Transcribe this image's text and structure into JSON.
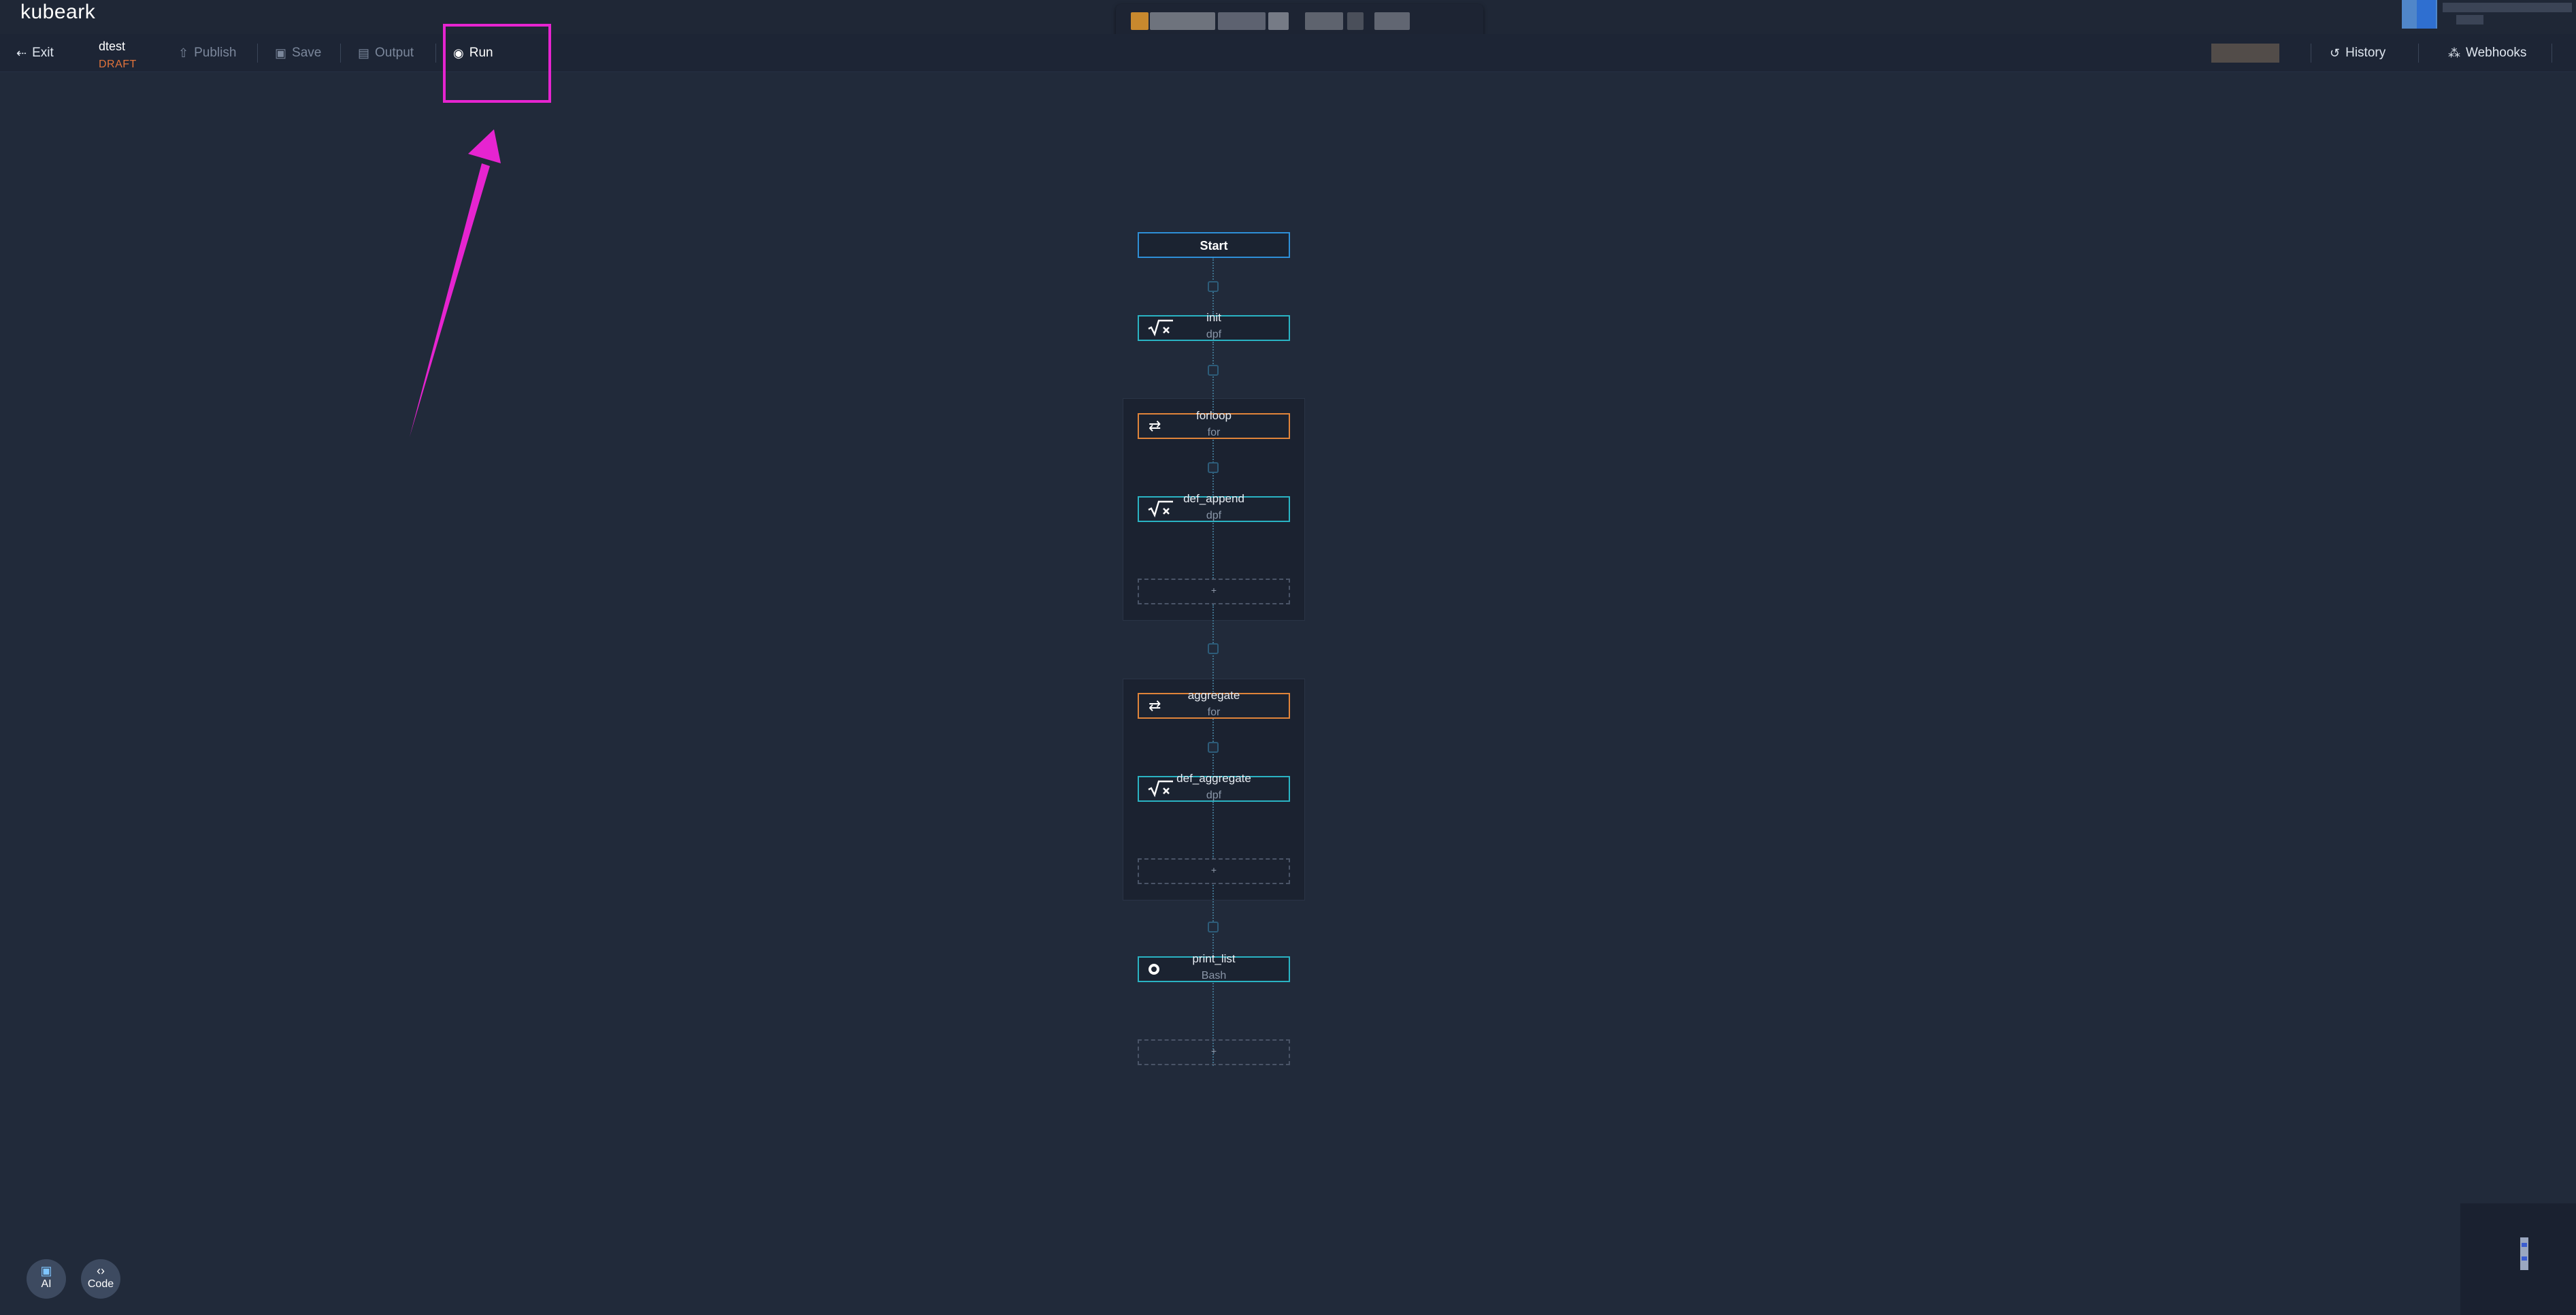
{
  "app": {
    "logo": "kubeark"
  },
  "toolbar": {
    "exit_label": "Exit",
    "flow_name": "dtest",
    "flow_status": "DRAFT",
    "publish_label": "Publish",
    "save_label": "Save",
    "output_label": "Output",
    "run_label": "Run",
    "history_label": "History",
    "webhooks_label": "Webhooks"
  },
  "workflow": {
    "start": {
      "title": "Start"
    },
    "nodes": [
      {
        "title": "init",
        "type": "dpf",
        "icon": "sqrt-x-icon"
      },
      {
        "title": "forloop",
        "type": "for",
        "icon": "loop-icon"
      },
      {
        "title": "def_append",
        "type": "dpf",
        "icon": "sqrt-x-icon"
      },
      {
        "title": "aggregate",
        "type": "for",
        "icon": "loop-icon"
      },
      {
        "title": "def_aggregate",
        "type": "dpf",
        "icon": "sqrt-x-icon"
      },
      {
        "title": "print_list",
        "type": "Bash",
        "icon": "bash-icon"
      }
    ],
    "placeholder_label": "+"
  },
  "fabs": {
    "ai_label": "AI",
    "code_label": "Code"
  },
  "colors": {
    "background": "#212a3a",
    "dpf_border": "#2ab3c3",
    "for_border": "#e0843a",
    "start_border": "#2e8fd7",
    "status_draft": "#e2733b",
    "highlight": "#e624d0"
  }
}
